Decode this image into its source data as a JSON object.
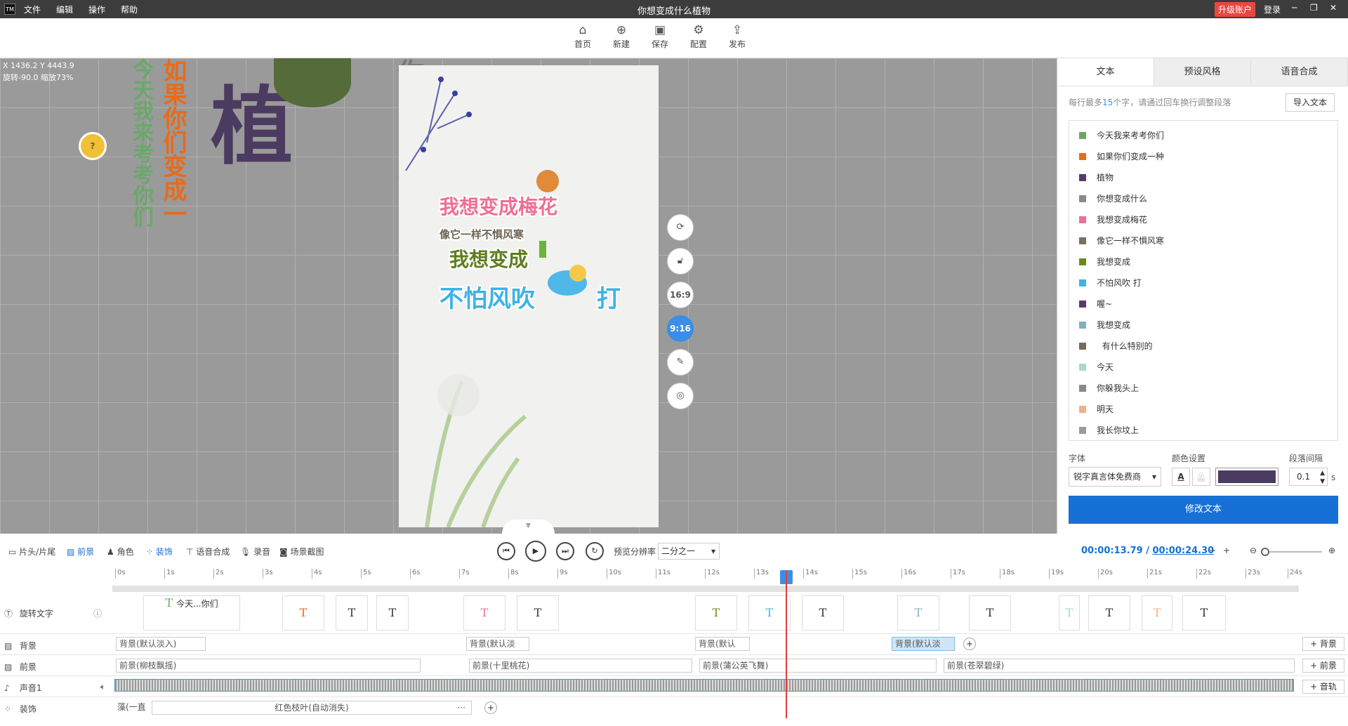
{
  "app": {
    "title": "你想变成什么植物",
    "logo": "TM",
    "menu": [
      "文件",
      "编辑",
      "操作",
      "帮助"
    ],
    "upgrade": "升级账户",
    "login": "登录"
  },
  "toolbar": [
    {
      "label": "首页",
      "icon": "home-icon"
    },
    {
      "label": "新建",
      "icon": "new-icon"
    },
    {
      "label": "保存",
      "icon": "save-icon"
    },
    {
      "label": "配置",
      "icon": "settings-icon"
    },
    {
      "label": "发布",
      "icon": "publish-icon"
    }
  ],
  "canvas": {
    "coords": "X 1436.2 Y 4443.9",
    "rotation": "旋转-90.0 缩放73%",
    "vtext1": "今天我来考考你们",
    "vtext2": "如果你们变成一",
    "big_text": "植",
    "vtext3": "你想变成什",
    "stage_lines": [
      "我想变成梅花",
      "像它一样不惧风寒",
      "我想变成",
      "不怕风吹",
      "打"
    ],
    "side_controls": [
      "sync-icon",
      "unlock-icon",
      "16:9",
      "9:16",
      "edit-icon",
      "target-icon"
    ]
  },
  "right_panel": {
    "tabs": [
      "文本",
      "预设风格",
      "语音合成"
    ],
    "hint_pre": "每行最多",
    "hint_num": "15",
    "hint_post": "个字，请通过回车换行调整段落",
    "import_btn": "导入文本",
    "lines": [
      {
        "text": "今天我来考考你们",
        "color": "#6aa86a"
      },
      {
        "text": "如果你们变成一种",
        "color": "#e86b1a"
      },
      {
        "text": "植物",
        "color": "#5a3a6a"
      },
      {
        "text": "你想变成什么",
        "color": "#8a8a8a"
      },
      {
        "text": "我想变成梅花",
        "color": "#ef6f93"
      },
      {
        "text": "像它一样不惧风寒",
        "color": "#7a7062"
      },
      {
        "text": "我想变成",
        "color": "#6b8a1e"
      },
      {
        "text": "不怕风吹    打",
        "color": "#3fb2e6"
      },
      {
        "text": "喔~",
        "color": "#5a3a6a"
      },
      {
        "text": "我想变成",
        "color": "#7fb0c0"
      },
      {
        "text": "  有什么特别的",
        "color": "#7a6a5a"
      },
      {
        "text": "今天",
        "color": "#a6dcc0"
      },
      {
        "text": "你躲我头上",
        "color": "#8a8a8a"
      },
      {
        "text": "明天",
        "color": "#f0b08a"
      },
      {
        "text": "我长你坟上",
        "color": "#9a9a9a"
      }
    ],
    "font_label": "字体",
    "font_value": "锐字真言体免费商",
    "color_label": "颜色设置",
    "text_color": "#4b3b60",
    "spacing_label": "段落间隔",
    "spacing_value": "0.1",
    "spacing_unit": "s",
    "apply_btn": "修改文本"
  },
  "timeline_toolbar": {
    "items": [
      "片头/片尾",
      "前景",
      "角色",
      "装饰",
      "语音合成",
      "录音",
      "场景截图"
    ],
    "preview_res_label": "预览分辨率",
    "preview_res_value": "二分之一",
    "current_time": "00:00:13.79",
    "separator": "/",
    "total_time": "00:00:24.30"
  },
  "ruler": {
    "ticks": [
      "0s",
      "1s",
      "2s",
      "3s",
      "4s",
      "5s",
      "6s",
      "7s",
      "8s",
      "9s",
      "10s",
      "11s",
      "12s",
      "13s",
      "14s",
      "15s",
      "16s",
      "17s",
      "18s",
      "19s",
      "20s",
      "21s",
      "22s",
      "23s",
      "24s"
    ]
  },
  "tracks": {
    "text_label": "旋转文字",
    "text_clip_first": "今天...你们",
    "text_clip_glyph": "T",
    "bg_label": "背景",
    "bg_clips": [
      "背景(默认淡入)",
      "背景(默认淡",
      "背景(默认",
      "背景(默认淡"
    ],
    "fg_label": "前景",
    "fg_clips": [
      "前景(柳枝飘摇)",
      "前景(十里桃花)",
      "前景(蒲公英飞舞)",
      "前景(苍翠碧绿)"
    ],
    "audio_label": "声音1",
    "deco_label": "装饰",
    "deco_clips": [
      "藻(一直",
      "红色枝叶(自动消失)"
    ],
    "add_bg": "+ 背景",
    "add_fg": "+ 前景",
    "add_audio": "+ 音轨"
  }
}
